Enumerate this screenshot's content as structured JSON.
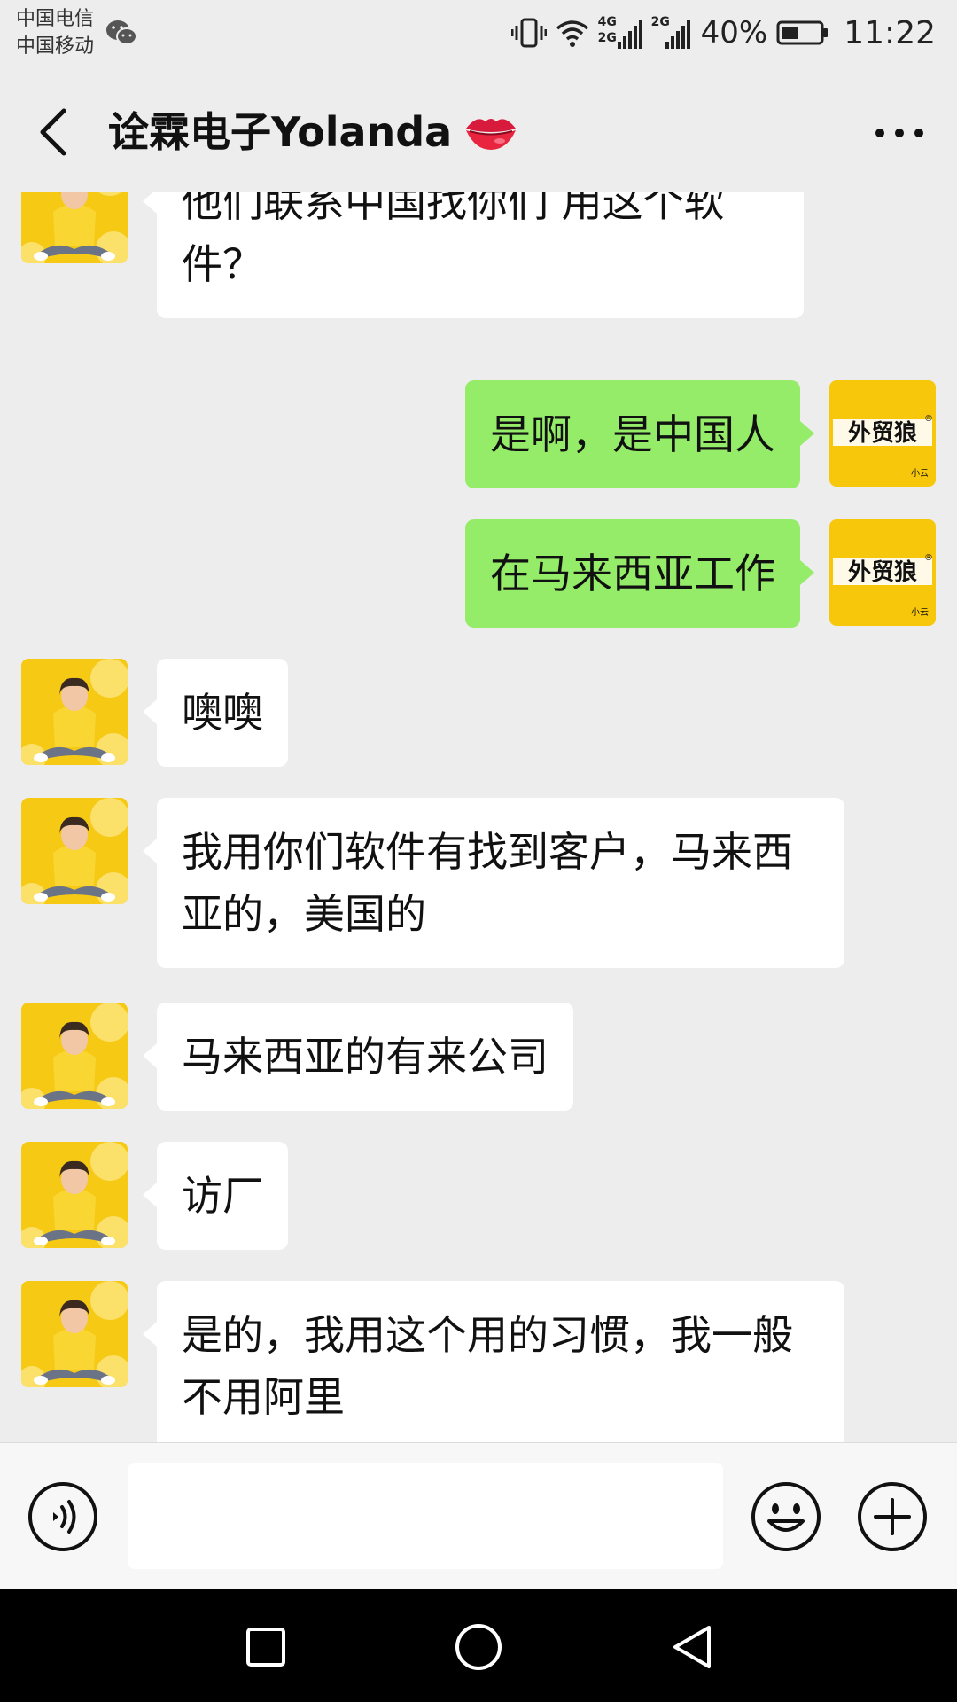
{
  "status_bar": {
    "carrier_1": "中国电信",
    "carrier_2": "中国移动",
    "battery": "40%",
    "time": "11:22",
    "network_1": "4G",
    "network_1b": "2G",
    "network_2": "2G"
  },
  "header": {
    "title": "诠霖电子Yolanda"
  },
  "brand_avatar": {
    "main": "外贸狼",
    "sub": "小云",
    "mark": "®"
  },
  "messages": [
    {
      "side": "in",
      "text": "他们联系中国找你们 用这个软件？"
    },
    {
      "side": "out",
      "text": "是啊，是中国人"
    },
    {
      "side": "out",
      "text": "在马来西亚工作"
    },
    {
      "side": "in",
      "text": "噢噢"
    },
    {
      "side": "in",
      "text": "我用你们软件有找到客户，马来西亚的，美国的"
    },
    {
      "side": "in",
      "text": "马来西亚的有来公司"
    },
    {
      "side": "in",
      "text": "访厂"
    },
    {
      "side": "in",
      "text": "是的，我用这个用的习惯，我一般不用阿里"
    }
  ],
  "colors": {
    "background": "#ededed",
    "bubble_out": "#95ec69",
    "bubble_in": "#ffffff",
    "avatar_yellow": "#f6c915"
  },
  "icons": {
    "back": "chevron-left-icon",
    "more": "more-dots-icon",
    "lips": "kiss-lips-icon",
    "voice": "voice-icon",
    "emoji": "emoji-icon",
    "plus": "plus-icon"
  }
}
